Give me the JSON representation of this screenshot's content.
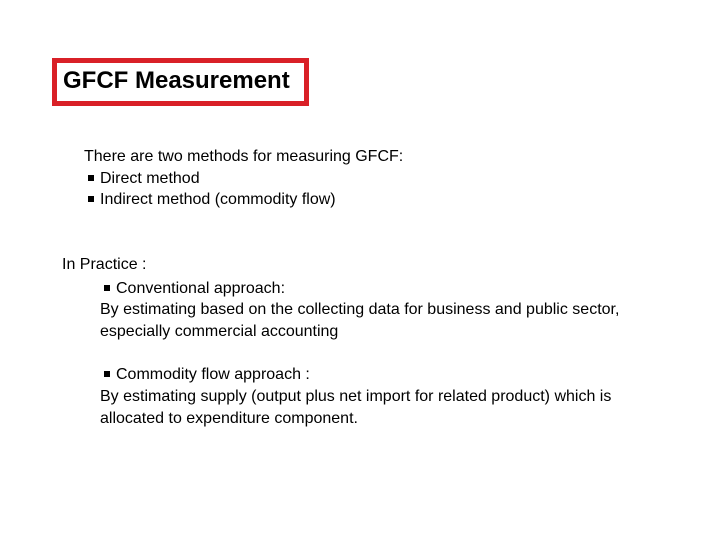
{
  "title": "GFCF Measurement",
  "intro": {
    "lead": "There are two methods for measuring GFCF:",
    "bullets": [
      "Direct method",
      "Indirect method (commodity flow)"
    ]
  },
  "practice": {
    "heading": "In Practice :",
    "items": [
      {
        "title": "Conventional approach:",
        "body": "By estimating based on the collecting data for business and public sector, especially  commercial accounting"
      },
      {
        "title": "Commodity flow approach :",
        "body": "By estimating supply (output plus net import for related product) which is allocated to expenditure component."
      }
    ]
  }
}
